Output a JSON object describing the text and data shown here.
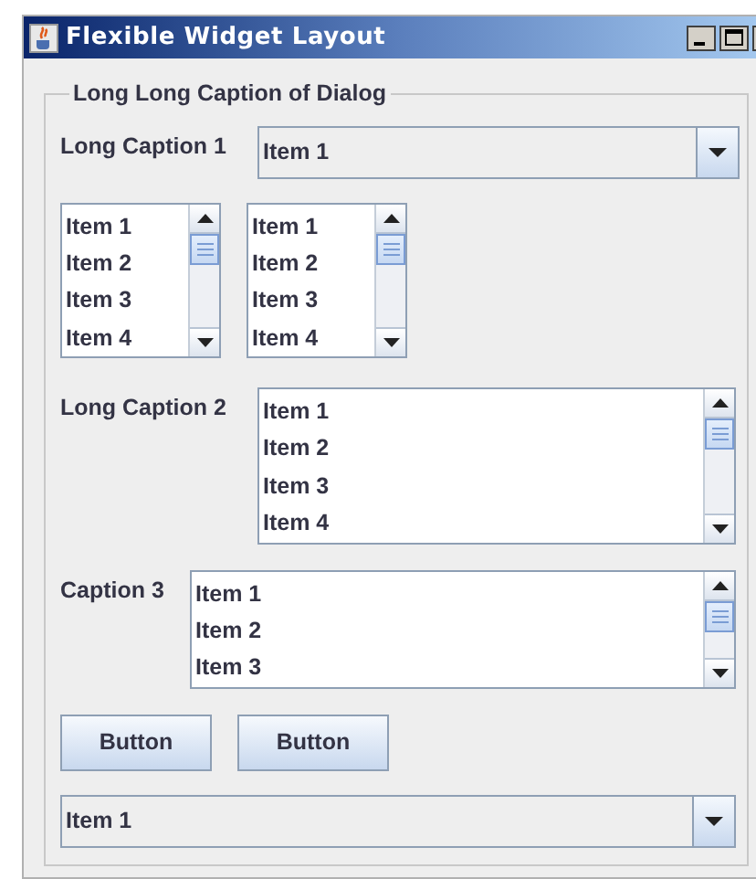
{
  "window": {
    "title": "Flexible Widget Layout"
  },
  "group": {
    "caption": "Long Long Caption of Dialog"
  },
  "caption_1": "Long Caption 1",
  "combo_1": {
    "value": "Item 1"
  },
  "small_lists": [
    {
      "items": [
        "Item 1",
        "Item 2",
        "Item 3",
        "Item 4"
      ]
    },
    {
      "items": [
        "Item 1",
        "Item 2",
        "Item 3",
        "Item 4"
      ]
    }
  ],
  "caption_2": "Long Caption 2",
  "list_2": {
    "items": [
      "Item 1",
      "Item 2",
      "Item 3",
      "Item 4"
    ]
  },
  "caption_3": "Caption 3",
  "list_3": {
    "items": [
      "Item 1",
      "Item 2",
      "Item 3"
    ]
  },
  "buttons": [
    "Button",
    "Button"
  ],
  "combo_2": {
    "value": "Item 1"
  }
}
